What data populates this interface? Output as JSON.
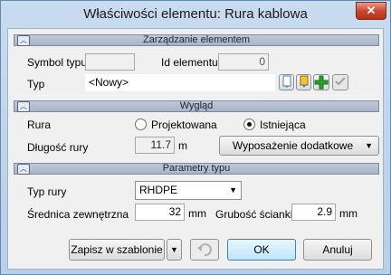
{
  "window": {
    "title": "Właściwości elementu: Rura kablowa",
    "close_glyph": "✕"
  },
  "sections": {
    "management": "Zarządzanie elementem",
    "appearance": "Wygląd",
    "type_params": "Parametry typu"
  },
  "management": {
    "symbol_label": "Symbol typu",
    "symbol_value": "",
    "id_label": "Id elementu",
    "id_value": "0",
    "type_label": "Typ",
    "type_value": "<Nowy>"
  },
  "appearance": {
    "pipe_label": "Rura",
    "option_designed": "Projektowana",
    "option_existing": "Istniejąca",
    "selected": "Istniejąca",
    "length_label": "Długość rury",
    "length_value": "11.7",
    "length_unit": "m",
    "equipment_button": "Wyposażenie dodatkowe"
  },
  "type_params": {
    "pipe_type_label": "Typ rury",
    "pipe_type_value": "RHDPE",
    "outer_diam_label": "Średnica zewnętrzna",
    "outer_diam_value": "32",
    "outer_diam_unit": "mm",
    "wall_label": "Grubość ścianki",
    "wall_value": "2.9",
    "wall_unit": "mm"
  },
  "footer": {
    "save_template": "Zapisz w szablonie",
    "ok": "OK",
    "cancel": "Anuluj"
  },
  "colors": {
    "accent_green": "#2e9e2e",
    "close_red": "#c7432b"
  }
}
